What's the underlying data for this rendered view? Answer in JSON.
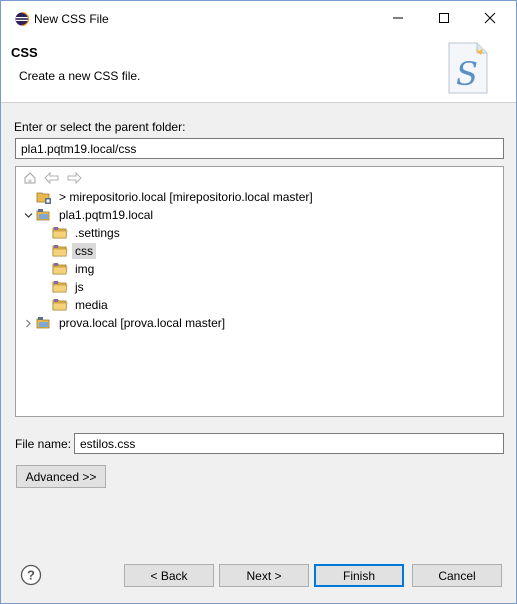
{
  "window": {
    "title": "New CSS File",
    "controls": {
      "minimize": "minimize",
      "maximize": "maximize",
      "close": "close"
    }
  },
  "header": {
    "title": "CSS",
    "description": "Create a new CSS file."
  },
  "folder": {
    "label": "Enter or select the parent folder:",
    "value": "pla1.pqtm19.local/css"
  },
  "tree": {
    "items": [
      {
        "label": "> mirepositorio.local [mirepositorio.local master]",
        "expander": "",
        "kind": "project-closed"
      },
      {
        "label": "pla1.pqtm19.local",
        "expander": "expanded",
        "kind": "project-open"
      },
      {
        "label": ".settings",
        "expander": "",
        "kind": "folder"
      },
      {
        "label": "css",
        "expander": "",
        "kind": "folder",
        "selected": true
      },
      {
        "label": "img",
        "expander": "",
        "kind": "folder"
      },
      {
        "label": "js",
        "expander": "",
        "kind": "folder"
      },
      {
        "label": "media",
        "expander": "",
        "kind": "folder"
      },
      {
        "label": "prova.local [prova.local master]",
        "expander": "collapsed",
        "kind": "project-open"
      }
    ]
  },
  "file_name": {
    "label": "File name:",
    "value": "estilos.css"
  },
  "buttons": {
    "advanced": "Advanced >>",
    "back": "< Back",
    "next": "Next >",
    "finish": "Finish",
    "cancel": "Cancel"
  },
  "colors": {
    "accent": "#0078d7",
    "folder": "#e8b84a"
  }
}
